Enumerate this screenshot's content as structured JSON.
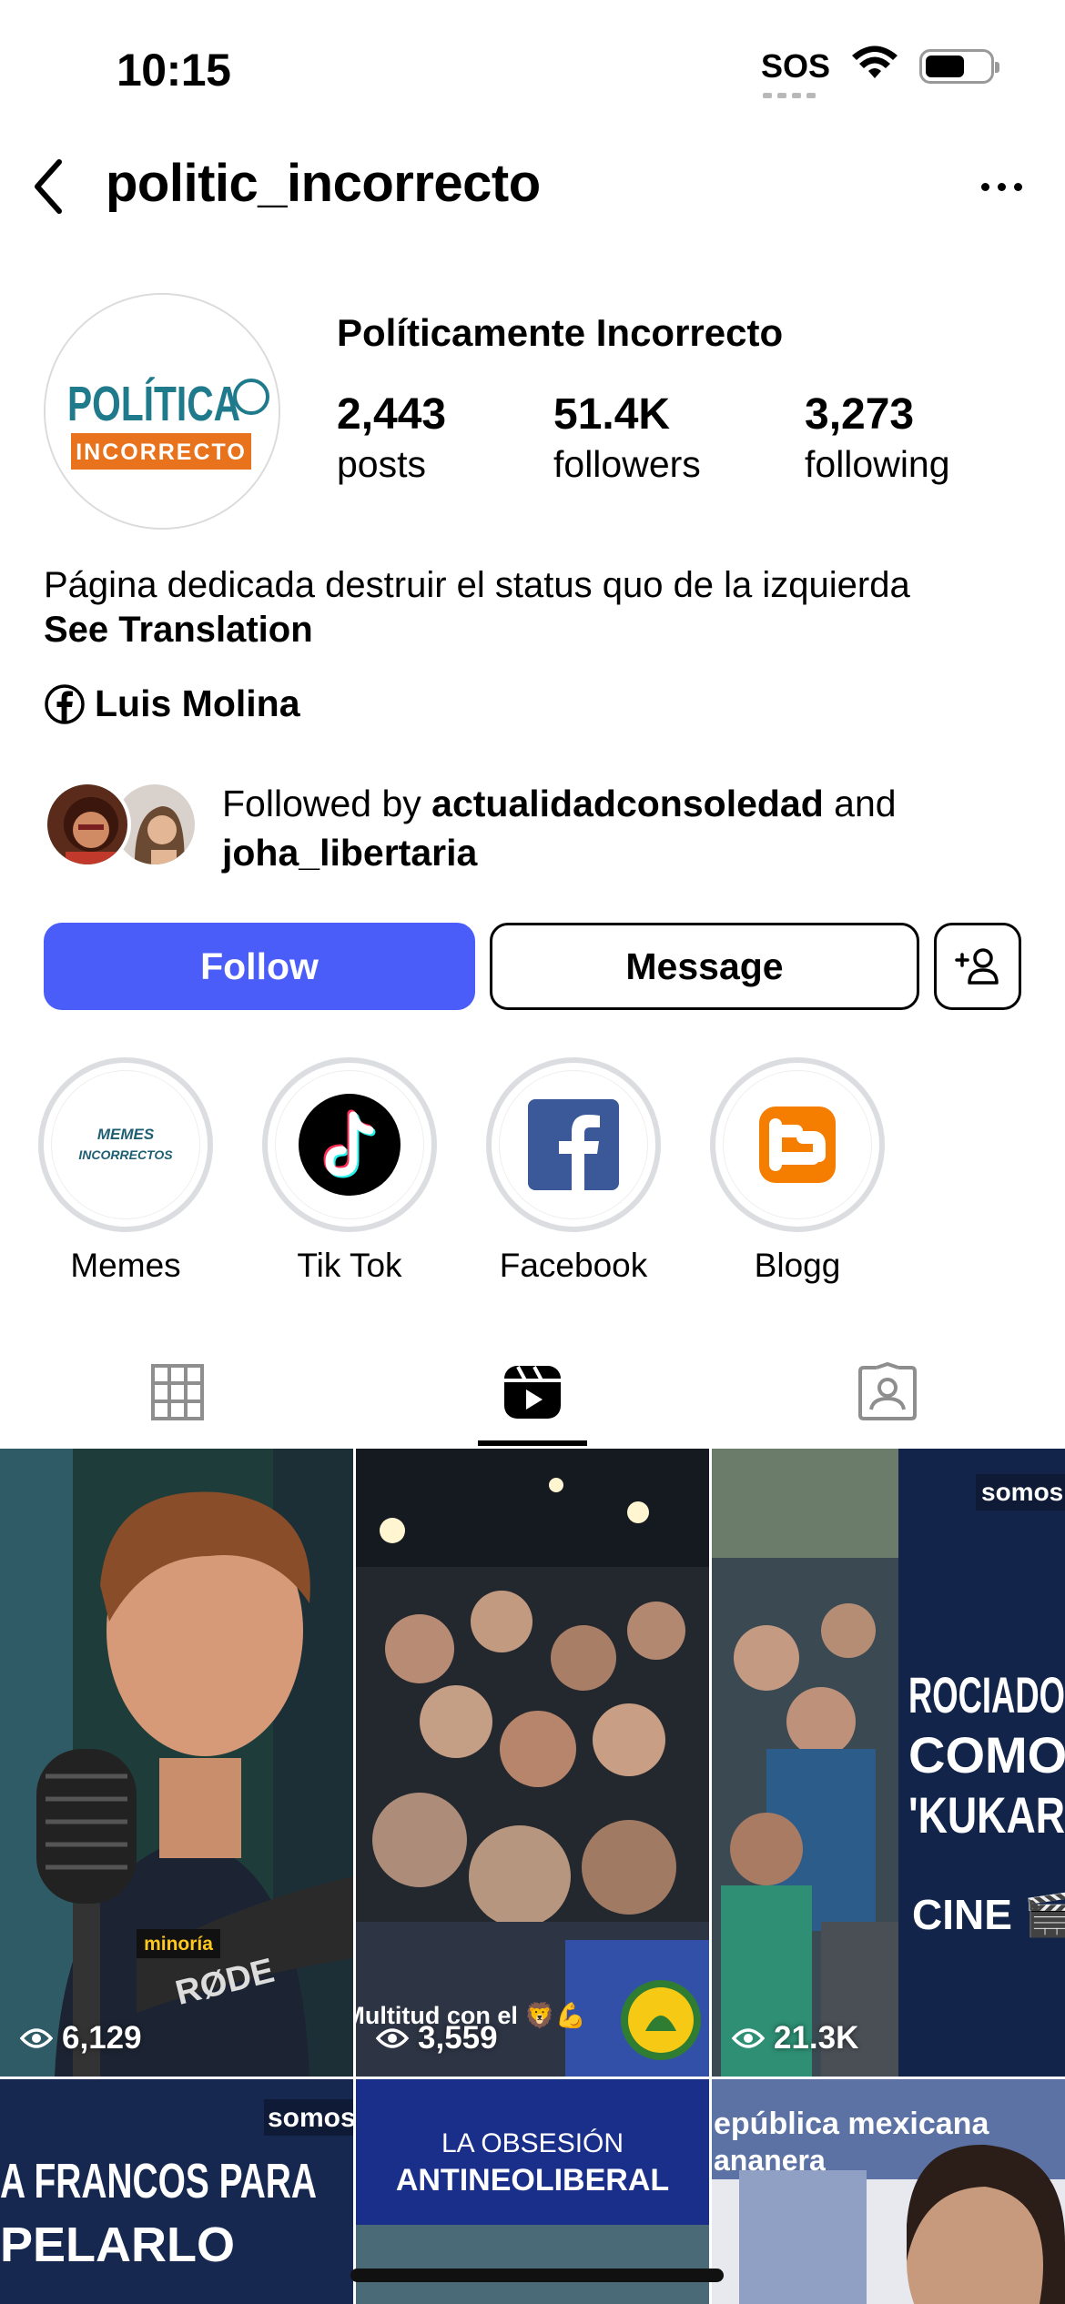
{
  "status_bar": {
    "time": "10:15",
    "sos": "SOS"
  },
  "header": {
    "username": "politic_incorrecto"
  },
  "profile": {
    "display_name": "Políticamente Incorrecto",
    "avatar_logo_line1": "POLÍTICA",
    "avatar_logo_line2": "INCORRECTO",
    "stats": [
      {
        "value": "2,443",
        "label": "posts"
      },
      {
        "value": "51.4K",
        "label": "followers"
      },
      {
        "value": "3,273",
        "label": "following"
      }
    ],
    "bio": "Página dedicada destruir el status quo de la izquierda",
    "see_translation": "See Translation",
    "facebook_link": "Luis Molina",
    "followed_by": {
      "prefix": "Followed by ",
      "user1": "actualidadconsoledad",
      "joiner": " and",
      "user2": "joha_libertaria"
    }
  },
  "actions": {
    "follow": "Follow",
    "message": "Message"
  },
  "highlights": [
    {
      "label": "Memes",
      "art_text_1": "MEMES",
      "art_text_2": "INCORRECTOS"
    },
    {
      "label": "Tik Tok"
    },
    {
      "label": "Facebook"
    },
    {
      "label": "Blogg"
    }
  ],
  "grid": {
    "posts": [
      {
        "views": "6,129",
        "caption": "minoría",
        "mic_text": "RØDE"
      },
      {
        "views": "3,559",
        "caption": "Multitud con el 🦁💪"
      },
      {
        "views": "21.3K",
        "badge": "somos",
        "headline_1": "ROCIADO",
        "headline_2": "COMO",
        "headline_3": "'KUKAR",
        "headline_4": "CINE 🎬"
      },
      {
        "badge": "somos",
        "headline_1": "A FRANCOS PARA",
        "headline_2": "PELARLO"
      },
      {
        "headline_1": "LA OBSESIÓN",
        "headline_2": "ANTINEOLIBERAL"
      },
      {
        "headline_1": "epública mexicana",
        "headline_2": "ananera"
      }
    ]
  },
  "colors": {
    "follow_button": "#4a5df9",
    "brand_teal": "#1f7a8c",
    "brand_orange": "#e8731c"
  }
}
